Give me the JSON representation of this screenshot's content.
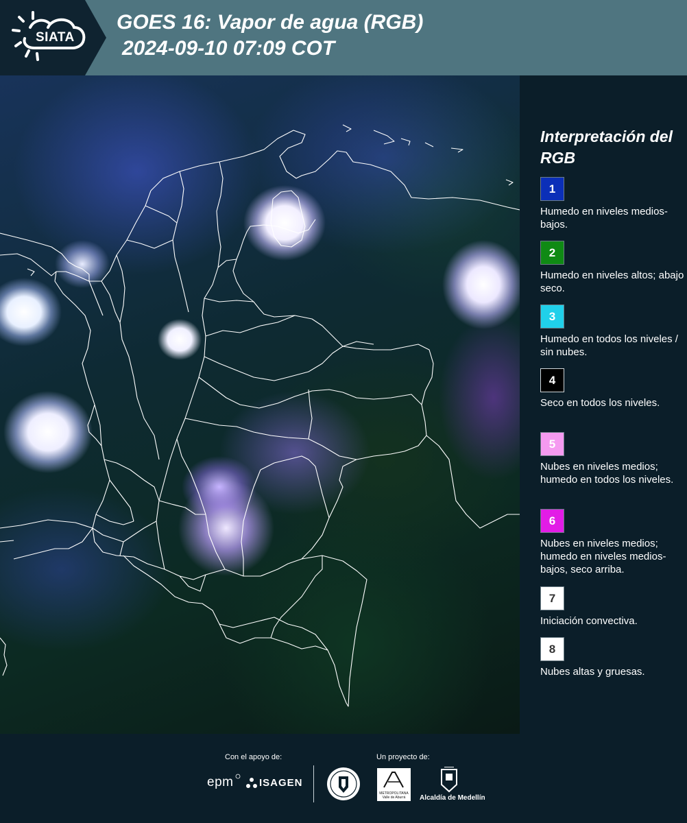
{
  "header": {
    "logo_text": "SIATA",
    "title_line1": "GOES 16: Vapor de agua (RGB)",
    "title_line2": "2024-09-10 07:09 COT",
    "background_color": "#4f7580",
    "logo_block_color": "#0f2330"
  },
  "map": {
    "icon": "satellite-rgb-map",
    "border_color": "#ffffff"
  },
  "legend": {
    "title": "Interpretación del RGB",
    "items": [
      {
        "number": "1",
        "color": "#0b2fb8",
        "text_color": "#ffffff",
        "description": "Humedo en niveles medios-bajos."
      },
      {
        "number": "2",
        "color": "#0f8a14",
        "text_color": "#ffffff",
        "description": "Humedo en niveles altos; abajo seco."
      },
      {
        "number": "3",
        "color": "#20d0ea",
        "text_color": "#ffffff",
        "description": "Humedo en todos los niveles / sin nubes."
      },
      {
        "number": "4",
        "color": "#000000",
        "text_color": "#ffffff",
        "description": "Seco en todos los niveles."
      },
      {
        "number": "5",
        "color": "#f59af0",
        "text_color": "#ffffff",
        "description": "Nubes en niveles medios; humedo en todos los niveles."
      },
      {
        "number": "6",
        "color": "#e21ce6",
        "text_color": "#ffffff",
        "description": "Nubes en niveles medios; humedo en niveles medios-bajos, seco arriba."
      },
      {
        "number": "7",
        "color": "#ffffff",
        "text_color": "#333333",
        "description": "Iniciación convectiva."
      },
      {
        "number": "8",
        "color": "#ffffff",
        "text_color": "#333333",
        "description": "Nubes altas y gruesas."
      }
    ]
  },
  "footer": {
    "support_label": "Con el apoyo de:",
    "project_label": "Un proyecto de:",
    "sponsor1": "epm",
    "sponsor2": "ISAGEN",
    "partner1_line1": "METROPOLITANA",
    "partner1_line2": "Valle de Aburrá",
    "partner2": "Alcaldía de Medellín"
  }
}
